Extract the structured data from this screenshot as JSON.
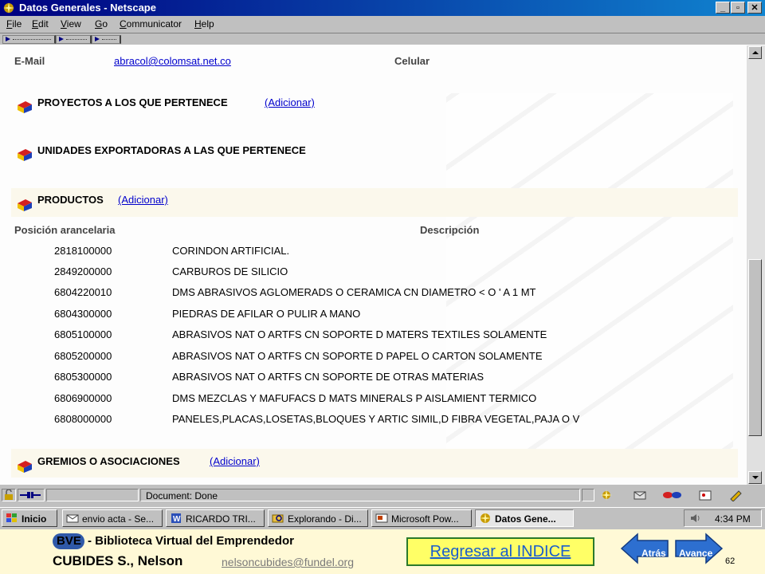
{
  "window": {
    "title": "Datos Generales - Netscape"
  },
  "menu": [
    "File",
    "Edit",
    "View",
    "Go",
    "Communicator",
    "Help"
  ],
  "page": {
    "email_label": "E-Mail",
    "email_value": "abracol@colomsat.net.co",
    "celular_label": "Celular",
    "sections": {
      "proyectos": {
        "title": "PROYECTOS A LOS QUE PERTENECE",
        "link": "(Adicionar)"
      },
      "unidades": {
        "title": "UNIDADES EXPORTADORAS A LAS QUE PERTENECE"
      },
      "productos": {
        "title": "PRODUCTOS",
        "link": "(Adicionar)"
      },
      "gremios": {
        "title": "GREMIOS O ASOCIACIONES",
        "link": "(Adicionar)"
      }
    },
    "table": {
      "col_code": "Posición arancelaria",
      "col_desc": "Descripción",
      "rows": [
        {
          "code": "2818100000",
          "desc": "CORINDON ARTIFICIAL."
        },
        {
          "code": "2849200000",
          "desc": "CARBUROS DE SILICIO"
        },
        {
          "code": "6804220010",
          "desc": "DMS ABRASIVOS AGLOMERADS O CERAMICA CN DIAMETRO < O ' A 1 MT"
        },
        {
          "code": "6804300000",
          "desc": "PIEDRAS DE AFILAR O PULIR A MANO"
        },
        {
          "code": "6805100000",
          "desc": "ABRASIVOS NAT O ARTFS CN SOPORTE D MATERS TEXTILES SOLAMENTE"
        },
        {
          "code": "6805200000",
          "desc": "ABRASIVOS NAT O ARTFS CN SOPORTE D PAPEL O CARTON SOLAMENTE"
        },
        {
          "code": "6805300000",
          "desc": "ABRASIVOS NAT O ARTFS CN SOPORTE DE OTRAS MATERIAS"
        },
        {
          "code": "6806900000",
          "desc": "DMS MEZCLAS Y MAFUFACS D MATS MINERALS P AISLAMIENT TERMICO"
        },
        {
          "code": "6808000000",
          "desc": "PANELES,PLACAS,LOSETAS,BLOQUES Y ARTIC SIMIL,D FIBRA VEGETAL,PAJA O V"
        }
      ]
    }
  },
  "status": {
    "text": "Document: Done"
  },
  "taskbar": {
    "start": "Inicio",
    "tasks": [
      "envio acta - Se...",
      "RICARDO TRI...",
      "Explorando - Di...",
      "Microsoft Pow...",
      "Datos Gene..."
    ],
    "clock": "4:34 PM"
  },
  "footer": {
    "bve": "BVE",
    "line1": "- Biblioteca Virtual del Emprendedor",
    "line2": "CUBIDES S., Nelson",
    "email": "nelsoncubides@fundel.org",
    "indice": "Regresar al INDICE",
    "back": "Atrás",
    "forward": "Avance",
    "slide_number": "62"
  },
  "colors": {
    "title_bar": "#000080",
    "link": "#0000cc",
    "band": "#fbf8ec",
    "footer_bg": "#fff9d6"
  }
}
